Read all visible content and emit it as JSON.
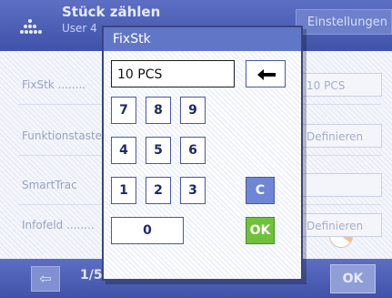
{
  "background": {
    "title": "Stück zählen",
    "subtitle": "User 4",
    "tab": "Einstellungen",
    "rows": [
      {
        "label": "FixStk ........",
        "value": "10 PCS"
      },
      {
        "label": "Funktionstasten",
        "value": "Definieren"
      },
      {
        "label": "SmartTrac",
        "value": ""
      },
      {
        "label": "Infofeld ........",
        "value": "Definieren"
      }
    ],
    "footer": {
      "back_icon": "arrow-left-icon",
      "page": "1/5",
      "ok": "OK"
    }
  },
  "dialog": {
    "title": "FixStk",
    "input_value": "10 PCS",
    "backspace_icon": "backspace-arrow-icon",
    "keys": {
      "k7": "7",
      "k8": "8",
      "k9": "9",
      "k4": "4",
      "k5": "5",
      "k6": "6",
      "k1": "1",
      "k2": "2",
      "k3": "3",
      "k0": "0",
      "clear": "C",
      "ok": "OK"
    },
    "colors": {
      "title_bar": "#6276c7",
      "clear_key": "#6f86d6",
      "ok_key": "#6fc13a"
    }
  }
}
